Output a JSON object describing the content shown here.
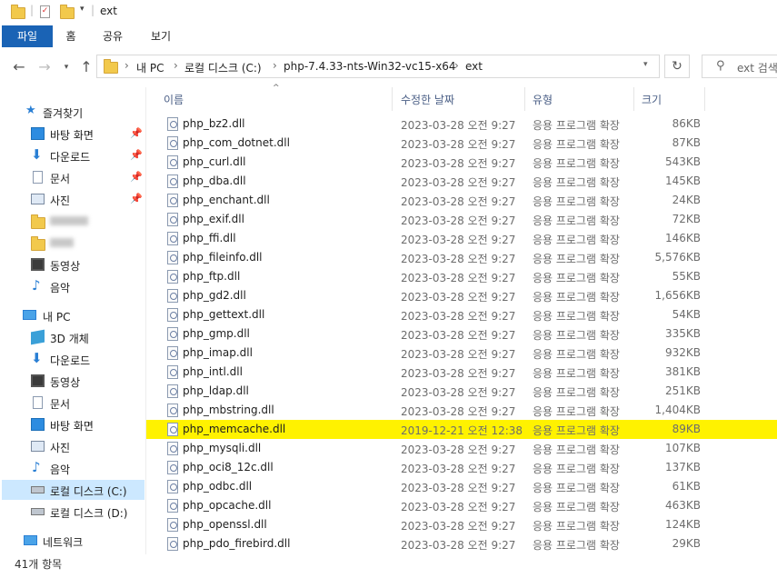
{
  "title": "ext",
  "ribbon_tabs": [
    "파일",
    "홈",
    "공유",
    "보기"
  ],
  "address": {
    "breadcrumbs": [
      "내 PC",
      "로컬 디스크 (C:)",
      "php-7.4.33-nts-Win32-vc15-x64",
      "ext"
    ],
    "search_placeholder": "ext 검색"
  },
  "nav": {
    "quick_access": "즐겨찾기",
    "quick_items": [
      "바탕 화면",
      "다운로드",
      "문서",
      "사진"
    ],
    "media_items": [
      "동영상",
      "음악"
    ],
    "this_pc": "내 PC",
    "pc_items": [
      "3D 개체",
      "다운로드",
      "동영상",
      "문서",
      "바탕 화면",
      "사진",
      "음악",
      "로컬 디스크 (C:)",
      "로컬 디스크 (D:)"
    ],
    "network": "네트워크"
  },
  "columns": {
    "name": "이름",
    "date": "수정한 날짜",
    "type": "유형",
    "size": "크기"
  },
  "files": [
    {
      "name": "php_bz2.dll",
      "date": "2023-03-28 오전 9:27",
      "type": "응용 프로그램 확장",
      "size": "86KB"
    },
    {
      "name": "php_com_dotnet.dll",
      "date": "2023-03-28 오전 9:27",
      "type": "응용 프로그램 확장",
      "size": "87KB"
    },
    {
      "name": "php_curl.dll",
      "date": "2023-03-28 오전 9:27",
      "type": "응용 프로그램 확장",
      "size": "543KB"
    },
    {
      "name": "php_dba.dll",
      "date": "2023-03-28 오전 9:27",
      "type": "응용 프로그램 확장",
      "size": "145KB"
    },
    {
      "name": "php_enchant.dll",
      "date": "2023-03-28 오전 9:27",
      "type": "응용 프로그램 확장",
      "size": "24KB"
    },
    {
      "name": "php_exif.dll",
      "date": "2023-03-28 오전 9:27",
      "type": "응용 프로그램 확장",
      "size": "72KB"
    },
    {
      "name": "php_ffi.dll",
      "date": "2023-03-28 오전 9:27",
      "type": "응용 프로그램 확장",
      "size": "146KB"
    },
    {
      "name": "php_fileinfo.dll",
      "date": "2023-03-28 오전 9:27",
      "type": "응용 프로그램 확장",
      "size": "5,576KB"
    },
    {
      "name": "php_ftp.dll",
      "date": "2023-03-28 오전 9:27",
      "type": "응용 프로그램 확장",
      "size": "55KB"
    },
    {
      "name": "php_gd2.dll",
      "date": "2023-03-28 오전 9:27",
      "type": "응용 프로그램 확장",
      "size": "1,656KB"
    },
    {
      "name": "php_gettext.dll",
      "date": "2023-03-28 오전 9:27",
      "type": "응용 프로그램 확장",
      "size": "54KB"
    },
    {
      "name": "php_gmp.dll",
      "date": "2023-03-28 오전 9:27",
      "type": "응용 프로그램 확장",
      "size": "335KB"
    },
    {
      "name": "php_imap.dll",
      "date": "2023-03-28 오전 9:27",
      "type": "응용 프로그램 확장",
      "size": "932KB"
    },
    {
      "name": "php_intl.dll",
      "date": "2023-03-28 오전 9:27",
      "type": "응용 프로그램 확장",
      "size": "381KB"
    },
    {
      "name": "php_ldap.dll",
      "date": "2023-03-28 오전 9:27",
      "type": "응용 프로그램 확장",
      "size": "251KB"
    },
    {
      "name": "php_mbstring.dll",
      "date": "2023-03-28 오전 9:27",
      "type": "응용 프로그램 확장",
      "size": "1,404KB"
    },
    {
      "name": "php_memcache.dll",
      "date": "2019-12-21 오전 12:38",
      "type": "응용 프로그램 확장",
      "size": "89KB",
      "highlighted": true
    },
    {
      "name": "php_mysqli.dll",
      "date": "2023-03-28 오전 9:27",
      "type": "응용 프로그램 확장",
      "size": "107KB"
    },
    {
      "name": "php_oci8_12c.dll",
      "date": "2023-03-28 오전 9:27",
      "type": "응용 프로그램 확장",
      "size": "137KB"
    },
    {
      "name": "php_odbc.dll",
      "date": "2023-03-28 오전 9:27",
      "type": "응용 프로그램 확장",
      "size": "61KB"
    },
    {
      "name": "php_opcache.dll",
      "date": "2023-03-28 오전 9:27",
      "type": "응용 프로그램 확장",
      "size": "463KB"
    },
    {
      "name": "php_openssl.dll",
      "date": "2023-03-28 오전 9:27",
      "type": "응용 프로그램 확장",
      "size": "124KB"
    },
    {
      "name": "php_pdo_firebird.dll",
      "date": "2023-03-28 오전 9:27",
      "type": "응용 프로그램 확장",
      "size": "29KB"
    }
  ],
  "status": "41개 항목",
  "colors": {
    "ribbon_file_tab": "#1a63b5",
    "highlight": "#fff200",
    "selection": "#cce8ff"
  }
}
